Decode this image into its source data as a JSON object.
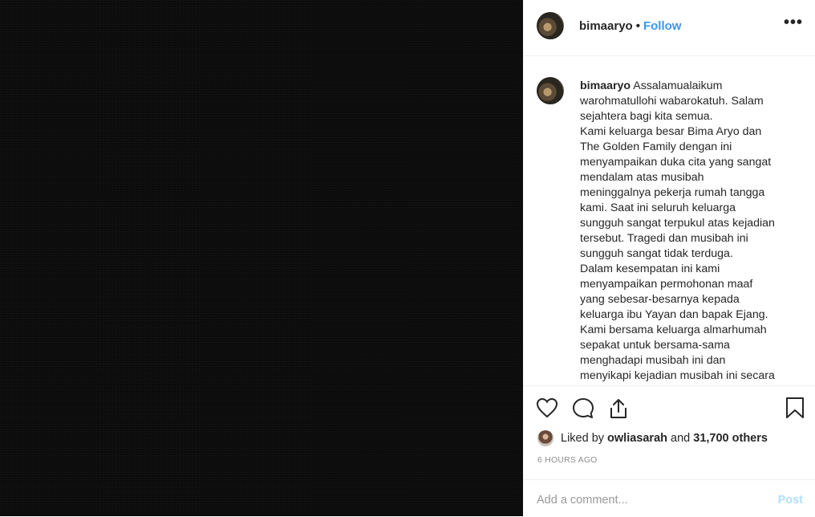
{
  "header": {
    "username": "bimaaryo",
    "separator": "•",
    "follow_label": "Follow",
    "more_label": "•••"
  },
  "caption": {
    "username": "bimaaryo",
    "text": "Assalamualaikum\nwarohmatullohi wabarokatuh. Salam\nsejahtera bagi kita semua.\nKami keluarga besar Bima Aryo dan\nThe Golden Family dengan ini\nmenyampaikan duka cita yang sangat\nmendalam atas musibah\nmeninggalnya pekerja rumah tangga\nkami. Saat ini seluruh keluarga\nsungguh sangat terpukul atas kejadian\ntersebut. Tragedi dan musibah ini\nsungguh sangat tidak terduga.\nDalam kesempatan ini kami\nmenyampaikan permohonan maaf\nyang sebesar-besarnya kepada\nkeluarga ibu Yayan dan bapak Ejang.\nKami bersama keluarga almarhumah\nsepakat untuk bersama-sama\nmenghadapi musibah ini dan\nmenyikapi kejadian musibah ini secara"
  },
  "actions": {
    "icons": [
      "heart-icon",
      "comment-icon",
      "share-icon",
      "bookmark-icon"
    ]
  },
  "likes": {
    "prefix": "Liked by",
    "user": "owliasarah",
    "middle": "and",
    "count_text": "31,700 others"
  },
  "timestamp": "6 HOURS AGO",
  "comment_bar": {
    "placeholder": "Add a comment...",
    "post_label": "Post"
  },
  "colors": {
    "accent": "#3897f0",
    "post_disabled": "#b2dffc",
    "media_bg": "#0b0b0b"
  }
}
